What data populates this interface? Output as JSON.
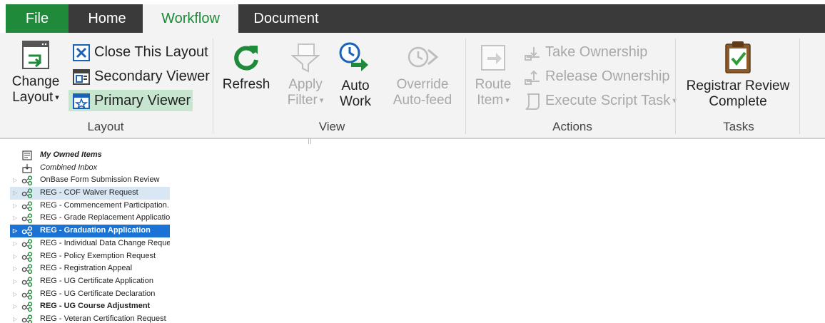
{
  "tabs": {
    "file": "File",
    "home": "Home",
    "workflow": "Workflow",
    "document": "Document"
  },
  "ribbon": {
    "layout_group": {
      "label": "Layout",
      "change_layout_line1": "Change",
      "change_layout_line2": "Layout",
      "close_this_layout": "Close This Layout",
      "secondary_viewer": "Secondary Viewer",
      "primary_viewer": "Primary Viewer"
    },
    "view_group": {
      "label": "View",
      "refresh": "Refresh",
      "apply_filter_line1": "Apply",
      "apply_filter_line2": "Filter",
      "auto_work_line1": "Auto",
      "auto_work_line2": "Work",
      "override_line1": "Override",
      "override_line2": "Auto-feed"
    },
    "actions_group": {
      "label": "Actions",
      "route_item_line1": "Route",
      "route_item_line2": "Item",
      "take_ownership": "Take Ownership",
      "release_ownership": "Release Ownership",
      "execute_script_task": "Execute Script Task"
    },
    "tasks_group": {
      "label": "Tasks",
      "registrar_line1": "Registrar Review",
      "registrar_line2": "Complete"
    }
  },
  "tree": {
    "items": [
      {
        "label": "My Owned Items",
        "style": "italic-bold",
        "icon": "owned-items-icon"
      },
      {
        "label": "Combined Inbox",
        "style": "italic",
        "icon": "inbox-icon"
      },
      {
        "label": "OnBase Form Submission Review",
        "style": "normal",
        "icon": "workflow-icon"
      },
      {
        "label": "REG - COF Waiver Request",
        "style": "hover",
        "icon": "workflow-icon"
      },
      {
        "label": "REG - Commencement Participation...",
        "style": "normal",
        "icon": "workflow-icon"
      },
      {
        "label": "REG - Grade Replacement Application",
        "style": "normal",
        "icon": "workflow-icon"
      },
      {
        "label": "REG - Graduation Application",
        "style": "selected",
        "icon": "workflow-icon"
      },
      {
        "label": "REG - Individual Data Change Request",
        "style": "normal",
        "icon": "workflow-icon"
      },
      {
        "label": "REG - Policy Exemption Request",
        "style": "normal",
        "icon": "workflow-icon"
      },
      {
        "label": "REG - Registration Appeal",
        "style": "normal",
        "icon": "workflow-icon"
      },
      {
        "label": "REG - UG Certificate Application",
        "style": "normal",
        "icon": "workflow-icon"
      },
      {
        "label": "REG - UG Certificate Declaration",
        "style": "normal",
        "icon": "workflow-icon"
      },
      {
        "label": "REG - UG Course Adjustment",
        "style": "bold",
        "icon": "workflow-icon"
      },
      {
        "label": "REG - Veteran Certification Request",
        "style": "normal",
        "icon": "workflow-icon"
      }
    ]
  },
  "colors": {
    "accent_green": "#1e8a3a",
    "selection_blue": "#1a73d4",
    "hover_blue": "#d9e7f4",
    "selected_button": "#c6e6cf"
  }
}
